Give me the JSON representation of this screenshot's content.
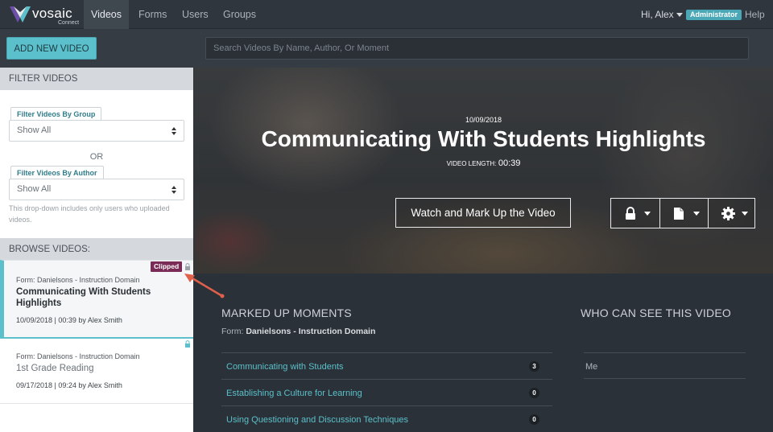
{
  "brand": {
    "name": "vosaic",
    "product": "Connect"
  },
  "nav": {
    "tabs": [
      {
        "label": "Videos",
        "active": true
      },
      {
        "label": "Forms",
        "active": false
      },
      {
        "label": "Users",
        "active": false
      },
      {
        "label": "Groups",
        "active": false
      }
    ],
    "greeting": "Hi, Alex",
    "role_badge": "Administrator",
    "help": "Help"
  },
  "toolbar": {
    "add_button": "ADD NEW VIDEO",
    "search_placeholder": "Search Videos By Name, Author, Or Moment"
  },
  "sidebar": {
    "filter_heading": "FILTER VIDEOS",
    "group_filter": {
      "label": "Filter Videos By Group",
      "value": "Show All"
    },
    "or_text": "OR",
    "author_filter": {
      "label": "Filter Videos By Author",
      "value": "Show All"
    },
    "author_hint": "This drop-down includes only users who uploaded videos.",
    "browse_heading": "BROWSE VIDEOS:",
    "videos": [
      {
        "form": "Form: Danielsons - Instruction Domain",
        "title": "Communicating With Students Highlights",
        "meta": "10/09/2018 | 00:39 by Alex Smith",
        "badge": "Clipped",
        "selected": true
      },
      {
        "form": "Form: Danielsons - Instruction Domain",
        "title": "1st Grade Reading",
        "meta": "09/17/2018 | 09:24 by Alex Smith",
        "selected": false
      }
    ]
  },
  "hero": {
    "date": "10/09/2018",
    "title": "Communicating With Students Highlights",
    "length_label": "VIDEO LENGTH:",
    "length_value": "00:39",
    "watch_button": "Watch and Mark Up the Video",
    "icons": [
      "lock-icon",
      "document-icon",
      "gear-icon"
    ]
  },
  "moments": {
    "heading": "MARKED UP MOMENTS",
    "form_prefix": "Form:",
    "form_name": "Danielsons - Instruction Domain",
    "items": [
      {
        "label": "Communicating with Students",
        "count": "3"
      },
      {
        "label": "Establishing a Culture for Learning",
        "count": "0"
      },
      {
        "label": "Using Questioning and Discussion Techniques",
        "count": "0"
      }
    ]
  },
  "visibility": {
    "heading": "WHO CAN SEE THIS VIDEO",
    "viewers": [
      "Me"
    ]
  },
  "colors": {
    "accent": "#5bc0cb",
    "clipped_badge": "#7b2c56",
    "annotation_arrow": "#e0614a"
  }
}
